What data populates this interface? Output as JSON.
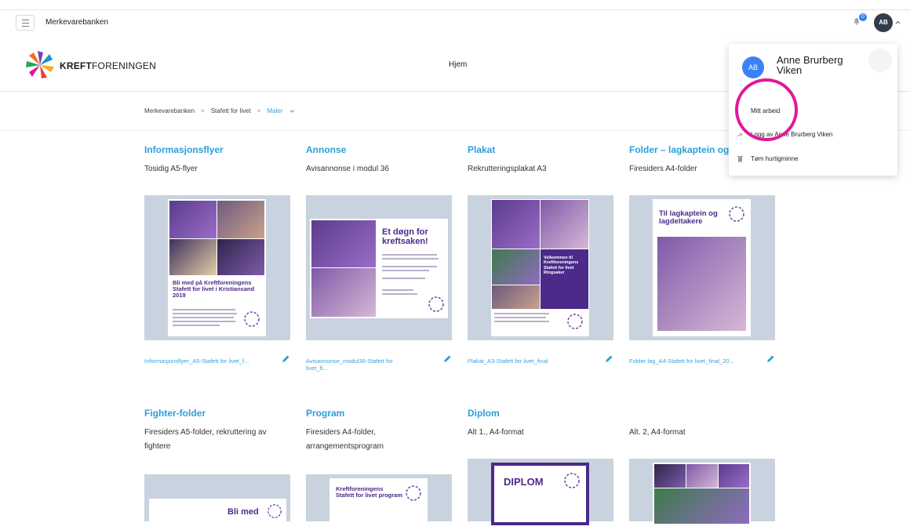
{
  "appbar": {
    "app_name": "Merkevarebanken",
    "notifications_count": "0",
    "avatar_initials": "AB"
  },
  "brand": {
    "logo_bold": "KREFT",
    "logo_regular": "FORENINGEN",
    "nav_home": "Hjem"
  },
  "breadcrumb": {
    "items": [
      "Merkevarebanken",
      "Stafett for livet",
      "Maler"
    ],
    "separator": ">"
  },
  "cards_row1": [
    {
      "title": "Informasjonsflyer",
      "subtitle": "Tosidig A5-flyer",
      "filename": "Informasjonsflyer_A5-Stafett for livet_f...",
      "thumb_heading": "Bli med på Kreftforeningens Stafett for livet i Kristiansand 2019"
    },
    {
      "title": "Annonse",
      "subtitle": "Avisannonse i modul 36",
      "filename": "Avisannonse_modul36-Stafett for livet_fi...",
      "thumb_heading": "Et døgn for kreftsaken!"
    },
    {
      "title": "Plakat",
      "subtitle": "Rekrutteringsplakat A3",
      "filename": "Plakat_A3-Stafett for livet_final",
      "thumb_heading": "Velkommen til Kreftforeningens Stafett for livet Ringsaker"
    },
    {
      "title": "Folder – lagkaptein og -d",
      "subtitle": "Firesiders A4-folder",
      "filename": "Folder lag_A4-Stafett for livet_final_20...",
      "thumb_heading": "Til lagkaptein og lagdeltakere"
    }
  ],
  "cards_row2": [
    {
      "title": "Fighter-folder",
      "subtitle": "Firesiders A5-folder, rekruttering av fightere",
      "thumb_heading": "Bli med"
    },
    {
      "title": "Program",
      "subtitle": "Firesiders A4-folder, arrangementsprogram",
      "thumb_heading": "Kreftforeningens Stafett for livet program"
    },
    {
      "title": "Diplom",
      "subtitle": "Alt 1., A4-format",
      "thumb_heading": "DIPLOM"
    },
    {
      "title": "",
      "subtitle": "Alt. 2, A4-format",
      "thumb_heading": ""
    }
  ],
  "dropdown": {
    "avatar_initials": "AB",
    "user_name": "Anne Brurberg Viken",
    "items": [
      "Mitt arbeid",
      "Logg av Anne Brurberg Viken",
      "Tøm hurtigminne"
    ]
  },
  "colors": {
    "accent": "#2b9fd8",
    "brand_purple": "#4b2a8a",
    "highlight": "#e2179a"
  }
}
